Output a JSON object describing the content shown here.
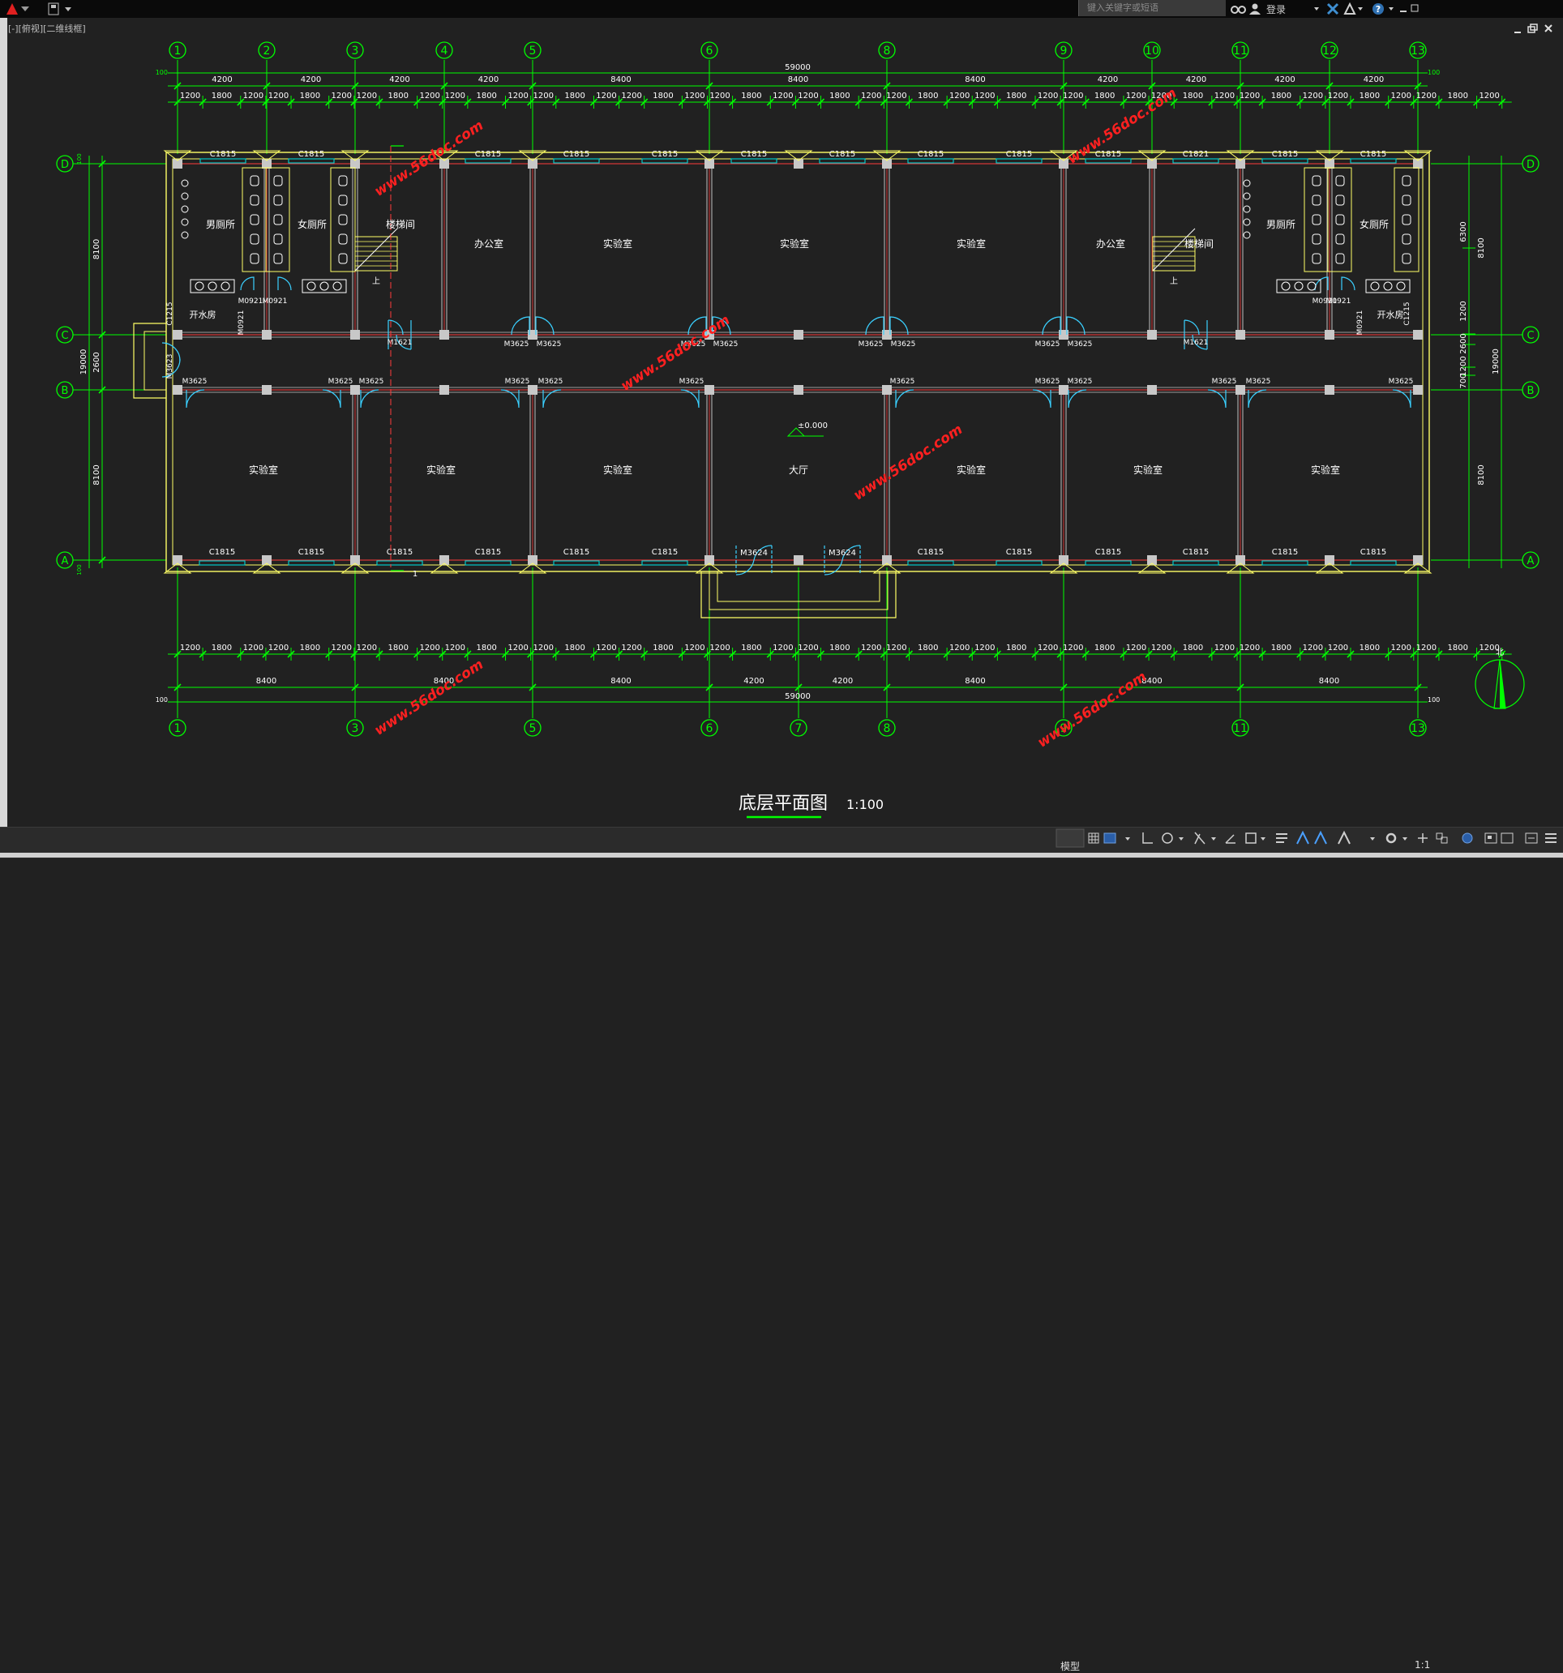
{
  "app": {
    "search_placeholder": "键入关键字或短语",
    "login_label": "登录",
    "viewport_label": "[-][俯视][二维线框]"
  },
  "status_bar": {
    "model_tab": "模型",
    "scale": "1:1"
  },
  "colors": {
    "axis": "#00ff00",
    "wall": "#ffff66",
    "window": "#00c8c8",
    "door": "#3ad0ff",
    "column": "#c8c8c8",
    "text": "#ffffff",
    "watermark": "#ff2020",
    "red_line": "#ff3b3b"
  },
  "drawing": {
    "title": "底层平面图",
    "scale": "1:100",
    "elevation": "±0.000",
    "watermark_text": "www.56doc.com",
    "axes_top": [
      "1",
      "2",
      "3",
      "4",
      "5",
      "6",
      "8",
      "9",
      "10",
      "11",
      "12",
      "13"
    ],
    "axes_bottom": [
      "1",
      "3",
      "5",
      "6",
      "7",
      "8",
      "9",
      "11",
      "13"
    ],
    "axes_side": [
      "D",
      "C",
      "B",
      "A"
    ],
    "top_total": "59000",
    "top_mid": [
      "4200",
      "4200",
      "4200",
      "4200",
      "8400",
      "8400",
      "8400",
      "4200",
      "4200",
      "4200",
      "4200"
    ],
    "top_detail": [
      "1200",
      "1800",
      "1200",
      "1200",
      "1800",
      "1200",
      "1200",
      "1800",
      "1200",
      "1200",
      "1800",
      "1200",
      "1200",
      "1800",
      "1200",
      "1200",
      "1800",
      "1200",
      "1200",
      "1800",
      "1200",
      "1200",
      "1800",
      "1200",
      "1200",
      "1800",
      "1200",
      "1200",
      "1800",
      "1200",
      "1200",
      "1800",
      "1200",
      "1200",
      "1800",
      "1200",
      "1200",
      "1800",
      "1200",
      "1200",
      "1800",
      "1200",
      "1200",
      "1800",
      "1200"
    ],
    "bottom_mid": [
      "8400",
      "8400",
      "8400",
      "4200",
      "4200",
      "8400",
      "8400",
      "8400"
    ],
    "bottom_total": "59000",
    "bottom_detail": [
      "1200",
      "1800",
      "1200",
      "1200",
      "1800",
      "1200",
      "1200",
      "1800",
      "1200",
      "1200",
      "1800",
      "1200",
      "1200",
      "1800",
      "1200",
      "1200",
      "1800",
      "1200",
      "1200",
      "1800",
      "1200",
      "1200",
      "1800",
      "1200",
      "1200",
      "1800",
      "1200",
      "1200",
      "1800",
      "1200",
      "1200",
      "1800",
      "1200",
      "1200",
      "1800",
      "1200",
      "1200",
      "1800",
      "1200",
      "1200",
      "1800",
      "1200",
      "1200",
      "1800",
      "1200"
    ],
    "side_left": [
      "8100",
      "2600",
      "8100"
    ],
    "side_left_total": "19000",
    "side_right": [
      "6300",
      "8100",
      "1200",
      "2600",
      "1200",
      "700",
      "8100"
    ],
    "side_right_total": "19000",
    "end_marks": [
      "100",
      "100",
      "100",
      "100",
      "100",
      "100"
    ],
    "windows_top": [
      "C1815",
      "C1815",
      "C1815",
      "C1815",
      "C1815",
      "C1815",
      "C1815",
      "C1815",
      "C1815",
      "C1815",
      "C1821",
      "C1815",
      "C1815"
    ],
    "windows_bottom": [
      "C1815",
      "C1815",
      "C1815",
      "C1815",
      "C1815",
      "C1815",
      "C1815",
      "C1815",
      "C1815",
      "C1815",
      "C1815",
      "C1815"
    ],
    "windows_side": [
      "C1215",
      "C1215"
    ],
    "doors": [
      "M0921",
      "M0921",
      "M0921",
      "M0921",
      "M0921",
      "M0921",
      "M1621",
      "M1621",
      "M3625",
      "M3625",
      "M3625",
      "M3625",
      "M3625",
      "M3625",
      "M3625",
      "M3625",
      "M3625",
      "M3625",
      "M3625",
      "M3625",
      "M3625",
      "M3625",
      "M3625",
      "M3625",
      "M3625",
      "M3625",
      "M3625",
      "M3625",
      "M3625",
      "M3625",
      "M3625",
      "M3625",
      "M3625",
      "M3624",
      "M3624",
      "M3623"
    ],
    "rooms_top": [
      "男厕所",
      "女厕所",
      "楼梯间",
      "办公室",
      "实验室",
      "实验室",
      "实验室",
      "办公室",
      "楼梯间",
      "男厕所",
      "女厕所"
    ],
    "rooms_small": [
      "开水房",
      "开水房"
    ],
    "stair_label": [
      "上",
      "上"
    ],
    "rooms_bottom": [
      "实验室",
      "实验室",
      "实验室",
      "大厅",
      "实验室",
      "实验室",
      "实验室"
    ],
    "north_label": "北",
    "misc_mark": "1"
  }
}
